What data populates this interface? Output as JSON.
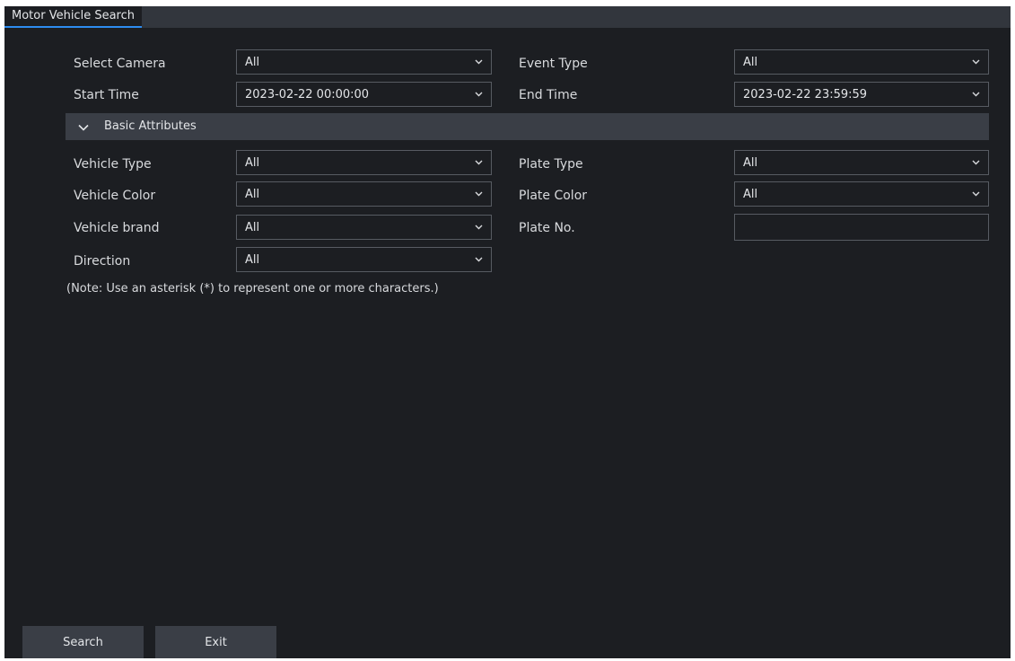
{
  "window": {
    "tab_title": "Motor Vehicle Search"
  },
  "form": {
    "select_camera": {
      "label": "Select Camera",
      "value": "All"
    },
    "event_type": {
      "label": "Event Type",
      "value": "All"
    },
    "start_time": {
      "label": "Start Time",
      "value": "2023-02-22 00:00:00"
    },
    "end_time": {
      "label": "End Time",
      "value": "2023-02-22 23:59:59"
    }
  },
  "basic_attributes": {
    "title": "Basic Attributes",
    "vehicle_type": {
      "label": "Vehicle Type",
      "value": "All"
    },
    "plate_type": {
      "label": "Plate Type",
      "value": "All"
    },
    "vehicle_color": {
      "label": "Vehicle Color",
      "value": "All"
    },
    "plate_color": {
      "label": "Plate Color",
      "value": "All"
    },
    "vehicle_brand": {
      "label": "Vehicle brand",
      "value": "All"
    },
    "plate_no": {
      "label": "Plate No.",
      "value": ""
    },
    "direction": {
      "label": "Direction",
      "value": "All"
    }
  },
  "note": "(Note: Use an asterisk (*) to represent one or more characters.)",
  "buttons": {
    "search": "Search",
    "exit": "Exit"
  },
  "colors": {
    "background": "#1c1e22",
    "panel": "#3a3e46",
    "field_border": "#575b62",
    "accent": "#2d8cf0",
    "text": "#d8dadd"
  }
}
